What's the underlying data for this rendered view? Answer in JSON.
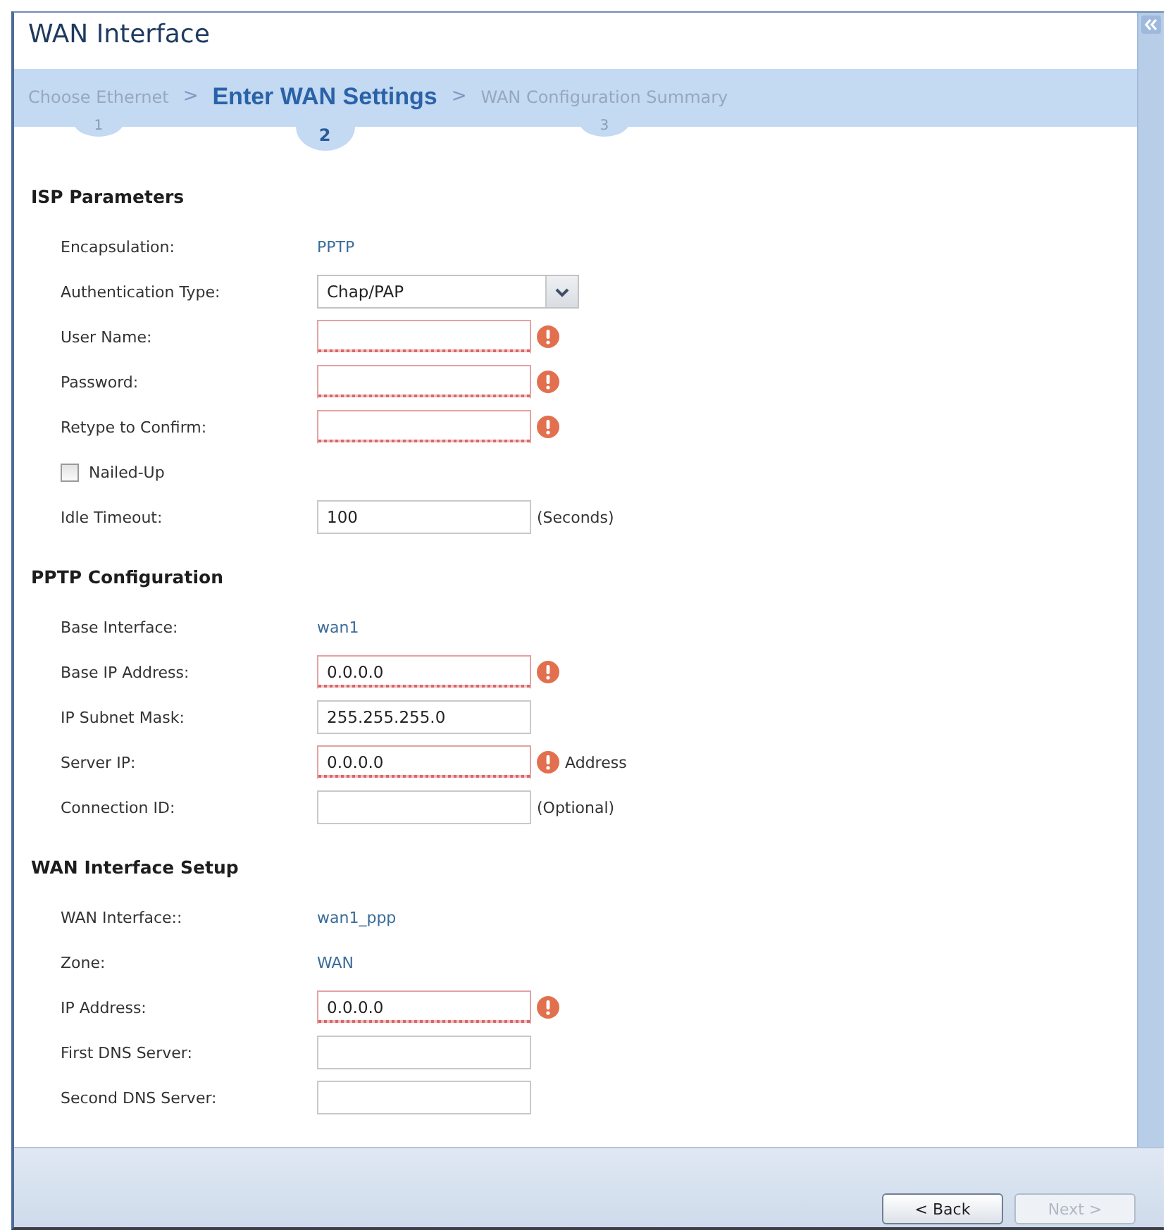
{
  "window": {
    "title": "WAN Interface"
  },
  "steps": [
    {
      "label": "Choose Ethernet",
      "number": "1",
      "selected": false
    },
    {
      "separator": ">",
      "label": "Enter WAN Settings",
      "number": "2",
      "selected": true
    },
    {
      "separator": ">",
      "label": "WAN Configuration Summary",
      "number": "3",
      "selected": false
    }
  ],
  "sections": [
    {
      "title": "ISP Parameters",
      "rows": [
        {
          "kind": "text",
          "label": "Encapsulation:",
          "value": "PPTP"
        },
        {
          "kind": "select",
          "label": "Authentication Type:",
          "value": "Chap/PAP"
        },
        {
          "kind": "input",
          "label": "User Name:",
          "invalid": true
        },
        {
          "kind": "input",
          "label": "Password:",
          "invalid": true
        },
        {
          "kind": "input",
          "label": "Retype to Confirm:",
          "invalid": true
        },
        {
          "kind": "checkbox",
          "label": "Nailed-Up",
          "checked": false
        },
        {
          "kind": "input",
          "label": "Idle Timeout:",
          "value": "100",
          "invalid": false,
          "note": "(Seconds)"
        }
      ]
    },
    {
      "title": "PPTP Configuration",
      "rows": [
        {
          "kind": "text",
          "label": "Base Interface:",
          "value": "wan1"
        },
        {
          "kind": "input",
          "label": "Base IP Address:",
          "value": "0.0.0.0",
          "invalid": true
        },
        {
          "kind": "input",
          "label": "IP Subnet Mask:",
          "value": "255.255.255.0",
          "invalid": false
        },
        {
          "kind": "input",
          "label": "Server IP:",
          "value": "0.0.0.0",
          "invalid": true,
          "note": "Address"
        },
        {
          "kind": "input",
          "label": "Connection ID:",
          "invalid": false,
          "note": "(Optional)"
        }
      ]
    },
    {
      "title": "WAN Interface Setup",
      "rows": [
        {
          "kind": "text",
          "label": "WAN Interface::",
          "value": "wan1_ppp"
        },
        {
          "kind": "text",
          "label": "Zone:",
          "value": "WAN"
        },
        {
          "kind": "input",
          "label": "IP Address:",
          "value": "0.0.0.0",
          "invalid": true
        },
        {
          "kind": "input",
          "label": "First DNS Server:",
          "invalid": false
        },
        {
          "kind": "input",
          "label": "Second DNS Server:",
          "invalid": false
        }
      ]
    }
  ],
  "buttons": [
    {
      "label": "< Back",
      "disabled": false
    },
    {
      "label": "Next >",
      "disabled": true
    }
  ]
}
